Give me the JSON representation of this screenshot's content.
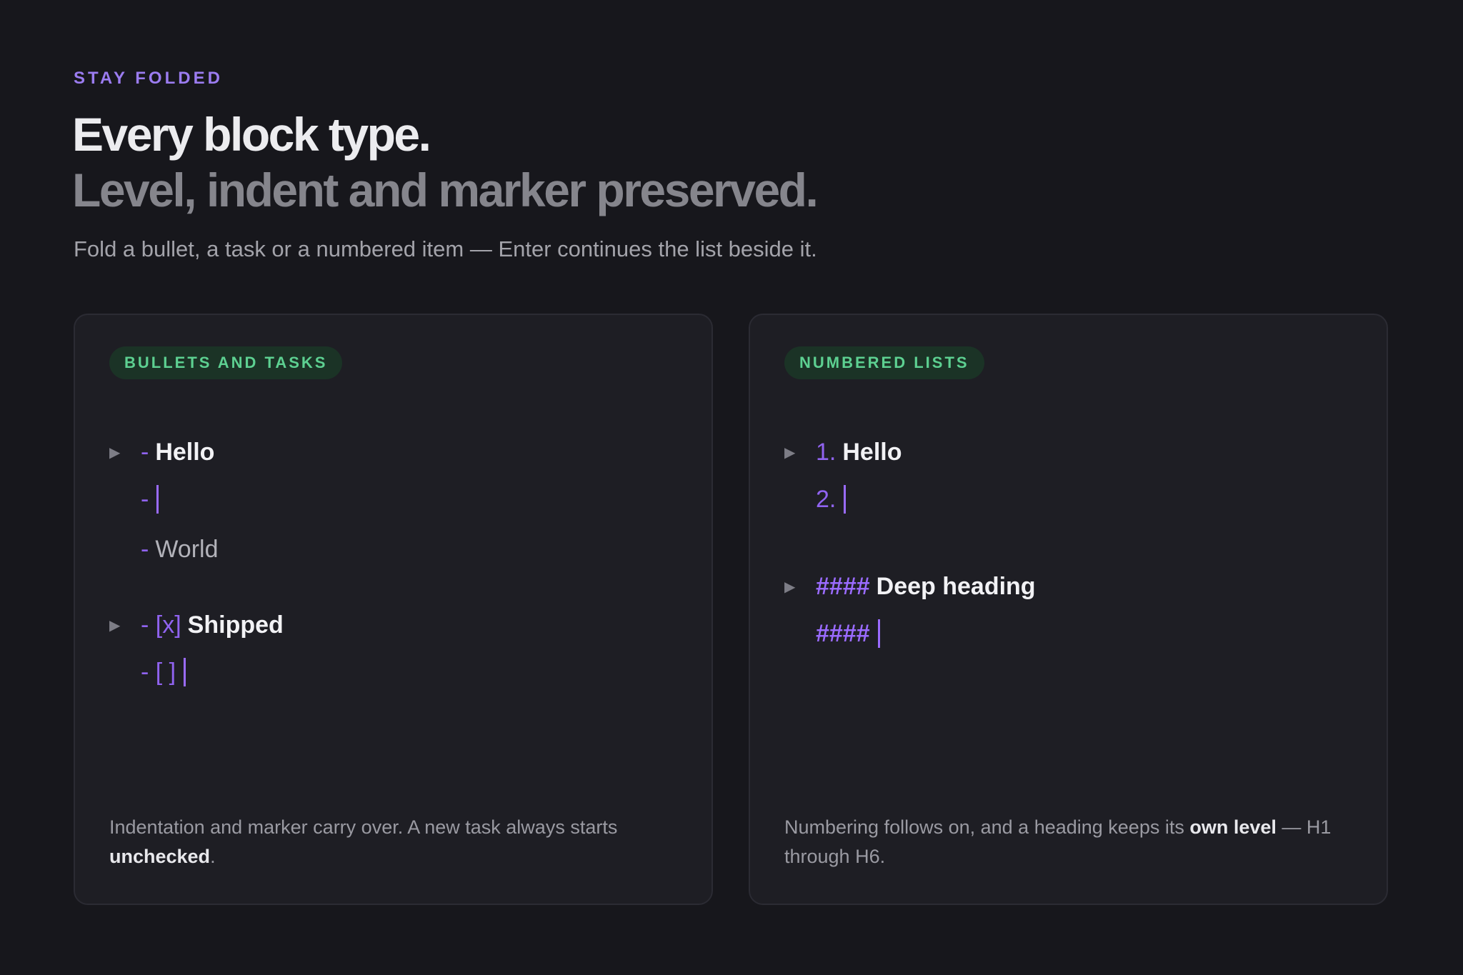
{
  "header": {
    "eyebrow": "STAY FOLDED",
    "title_line1": "Every block type.",
    "title_line2": "Level, indent and marker preserved.",
    "subtitle": "Fold a bullet, a task or a numbered item — Enter continues the list beside it."
  },
  "cards": {
    "bullets": {
      "badge": "BULLETS AND TASKS",
      "rows": [
        {
          "marker": "-",
          "text": "Hello"
        },
        {
          "marker": "-",
          "text": ""
        },
        {
          "marker": "-",
          "text": "World"
        },
        {
          "marker": "- [x]",
          "text": "Shipped"
        },
        {
          "marker": "- [ ]",
          "text": ""
        }
      ],
      "note_before": "Indentation and marker carry over. A new task always starts ",
      "note_bold": "unchecked",
      "note_after": "."
    },
    "numbered": {
      "badge": "NUMBERED LISTS",
      "rows": [
        {
          "marker": "1.",
          "text": "Hello"
        },
        {
          "marker": "2.",
          "text": ""
        },
        {
          "marker": "####",
          "text": "Deep heading"
        },
        {
          "marker": "####",
          "text": ""
        }
      ],
      "note_before": "Numbering follows on, and a heading keeps its ",
      "note_bold": "own level",
      "note_after": " — H1 through H6."
    }
  },
  "icons": {
    "fold": "▶"
  },
  "colors": {
    "background": "#17171c",
    "card": "#1e1e24",
    "accent": "#9a6bff",
    "badge_text": "#5dd091",
    "badge_bg": "#1b3326"
  }
}
